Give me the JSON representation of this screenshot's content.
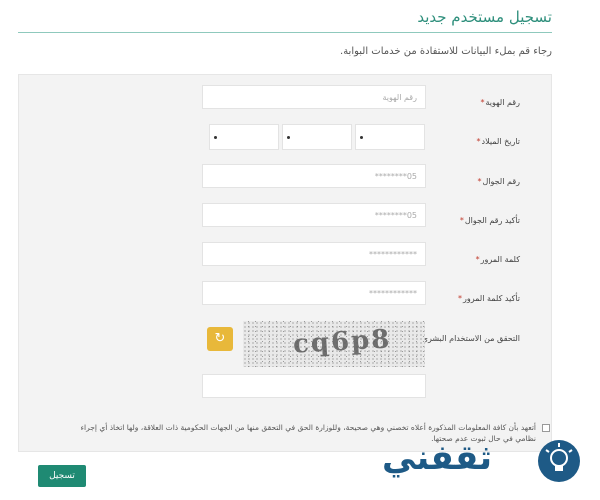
{
  "page": {
    "title": "تسجيل مستخدم جديد",
    "intro": "رجاء قم بملء البيانات للاستفادة من خدمات البوابة."
  },
  "form": {
    "national_id": {
      "label": "رقم الهوية",
      "placeholder": "رقم الهوية"
    },
    "birth_date": {
      "label": "تاريخ الميلاد"
    },
    "mobile": {
      "label": "رقم الجوال",
      "placeholder": "05********"
    },
    "mobile_confirm": {
      "label": "تأكيد رقم الجوال",
      "placeholder": "05********"
    },
    "password": {
      "label": "كلمة المرور",
      "placeholder": "************"
    },
    "password_confirm": {
      "label": "تأكيد كلمة المرور",
      "placeholder": "************"
    },
    "captcha": {
      "label": "التحقق من الاستخدام البشري",
      "text": "cq6p8"
    },
    "required_marker": "*"
  },
  "pledge": {
    "text": "أتعهد بأن كافة المعلومات المذكورة أعلاه تخصني وهي صحيحة، وللوزارة الحق في التحقق منها من الجهات الحكومية ذات العلاقة، ولها اتخاذ أي إجراء نظامي في حال ثبوت عدم صحتها."
  },
  "actions": {
    "submit_label": "تسجيل"
  },
  "icons": {
    "refresh": "refresh-icon"
  },
  "watermark": {
    "text": "ثقفني"
  },
  "colors": {
    "primary": "#1f8a73",
    "title": "#2e8f7c",
    "refresh": "#e8b83a",
    "watermark": "#1e5a86"
  }
}
